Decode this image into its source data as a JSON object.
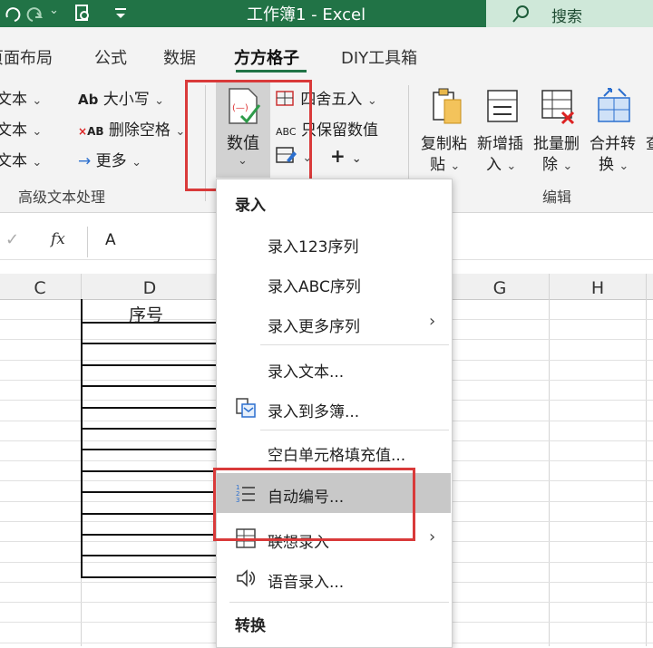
{
  "title_bar": {
    "document_title": "工作簿1 - Excel",
    "search_label": "搜索",
    "icons": [
      "redo-icon",
      "print-preview-icon",
      "customize-icon",
      "search-icon"
    ]
  },
  "tabs": [
    {
      "label": "页面布局"
    },
    {
      "label": "公式"
    },
    {
      "label": "数据"
    },
    {
      "label": "方方格子",
      "active": true
    },
    {
      "label": "DIY工具箱"
    }
  ],
  "ribbon": {
    "left_col": [
      "文本",
      "文本",
      "文本"
    ],
    "mid_col": {
      "case": "大小写",
      "case_icon_text": "Ab",
      "remove_space": "删除空格",
      "remove_space_icon_text": "AB",
      "more": "更多"
    },
    "group_text_label": "高级文本处理",
    "values_button": "数值",
    "values_icon_text": "(—)",
    "round": "四舍五入",
    "keep_values": "只保留数值",
    "keep_values_icon_text": "ABC",
    "plus": "+",
    "edit_buttons": [
      {
        "line1": "复制粘",
        "line2": "贴"
      },
      {
        "line1": "新增插",
        "line2": "入"
      },
      {
        "line1": "批量删",
        "line2": "除"
      },
      {
        "line1": "合并转",
        "line2": "换"
      }
    ],
    "edit_extra": "查",
    "group_edit_label": "编辑"
  },
  "formula_bar": {
    "fx": "fx",
    "value": "A"
  },
  "grid": {
    "columns": [
      "C",
      "D",
      "G",
      "H"
    ],
    "header_cell": "序号"
  },
  "menu": {
    "section1": "录入",
    "items": [
      {
        "label": "录入123序列",
        "icon": "",
        "submenu": false
      },
      {
        "label": "录入ABC序列",
        "icon": "",
        "submenu": false
      },
      {
        "label": "录入更多序列",
        "icon": "",
        "submenu": true
      },
      {
        "label": "录入文本...",
        "icon": "",
        "submenu": false
      },
      {
        "label": "录入到多簿...",
        "icon": "multi-workbook-icon",
        "submenu": false
      },
      {
        "label": "空白单元格填充值...",
        "icon": "",
        "submenu": false
      },
      {
        "label": "自动编号...",
        "icon": "numbered-list-icon",
        "submenu": false,
        "highlighted": true
      },
      {
        "label": "联想录入",
        "icon": "form-icon",
        "submenu": true
      },
      {
        "label": "语音录入...",
        "icon": "speaker-icon",
        "submenu": false
      }
    ],
    "section2": "转换"
  },
  "colors": {
    "excel_green": "#217346",
    "highlight_red": "#d93a3a",
    "menu_hover": "#c8c8c8"
  }
}
